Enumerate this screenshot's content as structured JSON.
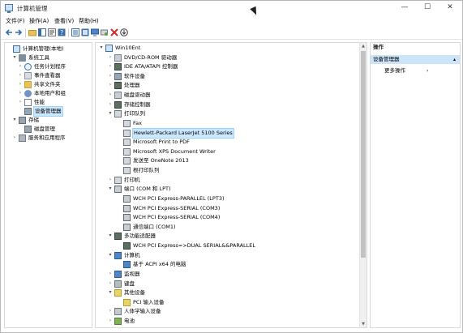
{
  "window": {
    "title": "计算机管理",
    "min_glyph": "—",
    "max_glyph": "☐",
    "close_glyph": "✕"
  },
  "menu": [
    "文件(F)",
    "操作(A)",
    "查看(V)",
    "帮助(H)"
  ],
  "toolbar_icons": [
    "back-arrow-icon",
    "forward-arrow-icon",
    "folder-up-icon",
    "show-tree-icon",
    "properties-icon",
    "help-icon",
    "detail-view-icon",
    "resource-view-icon",
    "monitor-icon",
    "scan-hardware-icon",
    "delete-icon",
    "update-driver-icon"
  ],
  "left_tree": [
    {
      "label": "计算机管理(本地)",
      "level": 0,
      "twisty": "",
      "icon": "i-comp"
    },
    {
      "label": "系统工具",
      "level": 1,
      "twisty": "▾",
      "icon": "i-tools"
    },
    {
      "label": "任务计划程序",
      "level": 2,
      "twisty": "›",
      "icon": "i-clock"
    },
    {
      "label": "事件查看器",
      "level": 2,
      "twisty": "›",
      "icon": "i-log"
    },
    {
      "label": "共享文件夹",
      "level": 2,
      "twisty": "›",
      "icon": "i-folder"
    },
    {
      "label": "本地用户和组",
      "level": 2,
      "twisty": "›",
      "icon": "i-users"
    },
    {
      "label": "性能",
      "level": 2,
      "twisty": "›",
      "icon": "i-perf"
    },
    {
      "label": "设备管理器",
      "level": 2,
      "twisty": "",
      "icon": "i-dev",
      "selected": true
    },
    {
      "label": "存储",
      "level": 1,
      "twisty": "▾",
      "icon": "i-disk"
    },
    {
      "label": "磁盘管理",
      "level": 2,
      "twisty": "",
      "icon": "i-disk"
    },
    {
      "label": "服务和应用程序",
      "level": 1,
      "twisty": "›",
      "icon": "i-svc"
    }
  ],
  "device_tree": [
    {
      "label": "Win10Ent",
      "level": 0,
      "twisty": "▾",
      "icon": "i-comp"
    },
    {
      "label": "DVD/CD-ROM 驱动器",
      "level": 1,
      "twisty": "›",
      "icon": "i-drive"
    },
    {
      "label": "IDE ATA/ATAPI 控制器",
      "level": 1,
      "twisty": "›",
      "icon": "i-chip"
    },
    {
      "label": "软件设备",
      "level": 1,
      "twisty": "›",
      "icon": "i-dev"
    },
    {
      "label": "处理器",
      "level": 1,
      "twisty": "›",
      "icon": "i-chip"
    },
    {
      "label": "磁盘驱动器",
      "level": 1,
      "twisty": "›",
      "icon": "i-drive"
    },
    {
      "label": "存储控制器",
      "level": 1,
      "twisty": "›",
      "icon": "i-chip"
    },
    {
      "label": "打印队列",
      "level": 1,
      "twisty": "▾",
      "icon": "i-printer"
    },
    {
      "label": "Fax",
      "level": 2,
      "twisty": "",
      "icon": "i-printer"
    },
    {
      "label": "Hewlett-Packard LaserJet 5100 Series",
      "level": 2,
      "twisty": "",
      "icon": "i-printer",
      "highlight": true
    },
    {
      "label": "Microsoft Print to PDF",
      "level": 2,
      "twisty": "",
      "icon": "i-printer"
    },
    {
      "label": "Microsoft XPS Document Writer",
      "level": 2,
      "twisty": "",
      "icon": "i-printer"
    },
    {
      "label": "发送至 OneNote 2013",
      "level": 2,
      "twisty": "",
      "icon": "i-printer"
    },
    {
      "label": "根打印队列",
      "level": 2,
      "twisty": "",
      "icon": "i-printer"
    },
    {
      "label": "打印机",
      "level": 1,
      "twisty": "›",
      "icon": "i-printer"
    },
    {
      "label": "端口 (COM 和 LPT)",
      "level": 1,
      "twisty": "▾",
      "icon": "i-port"
    },
    {
      "label": "WCH PCI Express-PARALLEL (LPT3)",
      "level": 2,
      "twisty": "",
      "icon": "i-port"
    },
    {
      "label": "WCH PCI Express-SERIAL (COM3)",
      "level": 2,
      "twisty": "",
      "icon": "i-port"
    },
    {
      "label": "WCH PCI Express-SERIAL (COM4)",
      "level": 2,
      "twisty": "",
      "icon": "i-port"
    },
    {
      "label": "通信端口 (COM1)",
      "level": 2,
      "twisty": "",
      "icon": "i-port"
    },
    {
      "label": "多功能适配器",
      "level": 1,
      "twisty": "▾",
      "icon": "i-chip"
    },
    {
      "label": "WCH PCI Express=>DUAL SERIAL&&PARALLEL",
      "level": 2,
      "twisty": "",
      "icon": "i-chip"
    },
    {
      "label": "计算机",
      "level": 1,
      "twisty": "▾",
      "icon": "i-monitor"
    },
    {
      "label": "基于 ACPI x64 的电脑",
      "level": 2,
      "twisty": "",
      "icon": "i-monitor"
    },
    {
      "label": "监视器",
      "level": 1,
      "twisty": "›",
      "icon": "i-monitor"
    },
    {
      "label": "键盘",
      "level": 1,
      "twisty": "›",
      "icon": "i-kbd"
    },
    {
      "label": "其他设备",
      "level": 1,
      "twisty": "▾",
      "icon": "i-warn"
    },
    {
      "label": "PCI 输入设备",
      "level": 2,
      "twisty": "",
      "icon": "i-warn"
    },
    {
      "label": "人体学输入设备",
      "level": 1,
      "twisty": "›",
      "icon": "i-hid"
    },
    {
      "label": "电池",
      "level": 1,
      "twisty": "›",
      "icon": "i-batt"
    }
  ],
  "actions": {
    "header": "操作",
    "section": "设备管理器",
    "more": "更多操作",
    "section_caret": "▴",
    "more_caret": "›"
  },
  "scroll": {
    "up": "▲",
    "down": "▼"
  }
}
